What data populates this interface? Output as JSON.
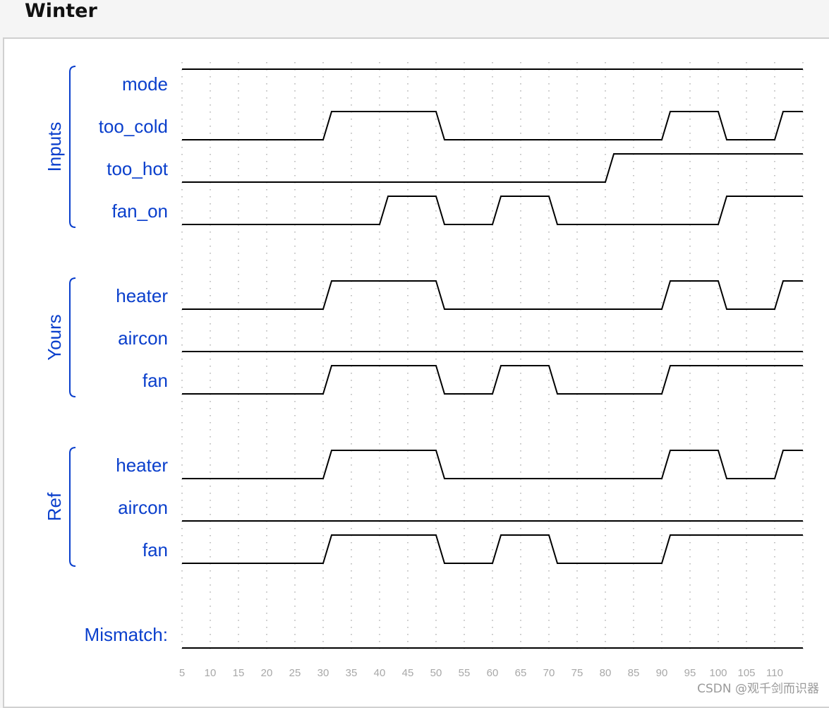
{
  "title": "Winter",
  "watermark": "CSDN @观千剑而识器",
  "colors": {
    "label": "#0a3fcc",
    "wave": "#000000",
    "grid": "#b0b0b0",
    "tick": "#a8a8a8"
  },
  "time_axis": {
    "start": 5,
    "end": 115,
    "tick_step": 5,
    "ticks": [
      5,
      10,
      15,
      20,
      25,
      30,
      35,
      40,
      45,
      50,
      55,
      60,
      65,
      70,
      75,
      80,
      85,
      90,
      95,
      100,
      105,
      110
    ]
  },
  "groups": [
    {
      "name": "Inputs",
      "signals": [
        {
          "label": "mode",
          "init": 1,
          "toggles": []
        },
        {
          "label": "too_cold",
          "init": 0,
          "toggles": [
            30,
            50,
            90,
            100,
            110
          ]
        },
        {
          "label": "too_hot",
          "init": 0,
          "toggles": [
            80
          ]
        },
        {
          "label": "fan_on",
          "init": 0,
          "toggles": [
            40,
            50,
            60,
            70,
            100
          ]
        }
      ]
    },
    {
      "name": "Yours",
      "signals": [
        {
          "label": "heater",
          "init": 0,
          "toggles": [
            30,
            50,
            90,
            100,
            110
          ]
        },
        {
          "label": "aircon",
          "init": 0,
          "toggles": []
        },
        {
          "label": "fan",
          "init": 0,
          "toggles": [
            30,
            50,
            60,
            70,
            90
          ]
        }
      ]
    },
    {
      "name": "Ref",
      "signals": [
        {
          "label": "heater",
          "init": 0,
          "toggles": [
            30,
            50,
            90,
            100,
            110
          ]
        },
        {
          "label": "aircon",
          "init": 0,
          "toggles": []
        },
        {
          "label": "fan",
          "init": 0,
          "toggles": [
            30,
            50,
            60,
            70,
            90
          ]
        }
      ]
    }
  ],
  "mismatch": {
    "label": "Mismatch:",
    "init": 0,
    "toggles": []
  }
}
